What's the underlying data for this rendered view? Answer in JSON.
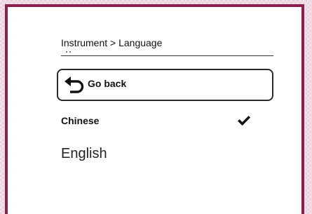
{
  "breadcrumb": {
    "text": "Instrument > Language"
  },
  "back_button": {
    "label": "Go back",
    "icon": "undo-arrow-icon"
  },
  "languages": [
    {
      "label": "Chinese",
      "selected": true
    },
    {
      "label": "English",
      "selected": false
    }
  ],
  "colors": {
    "frame": "#8d1f4f",
    "background": "#ffffff",
    "text": "#111111"
  }
}
